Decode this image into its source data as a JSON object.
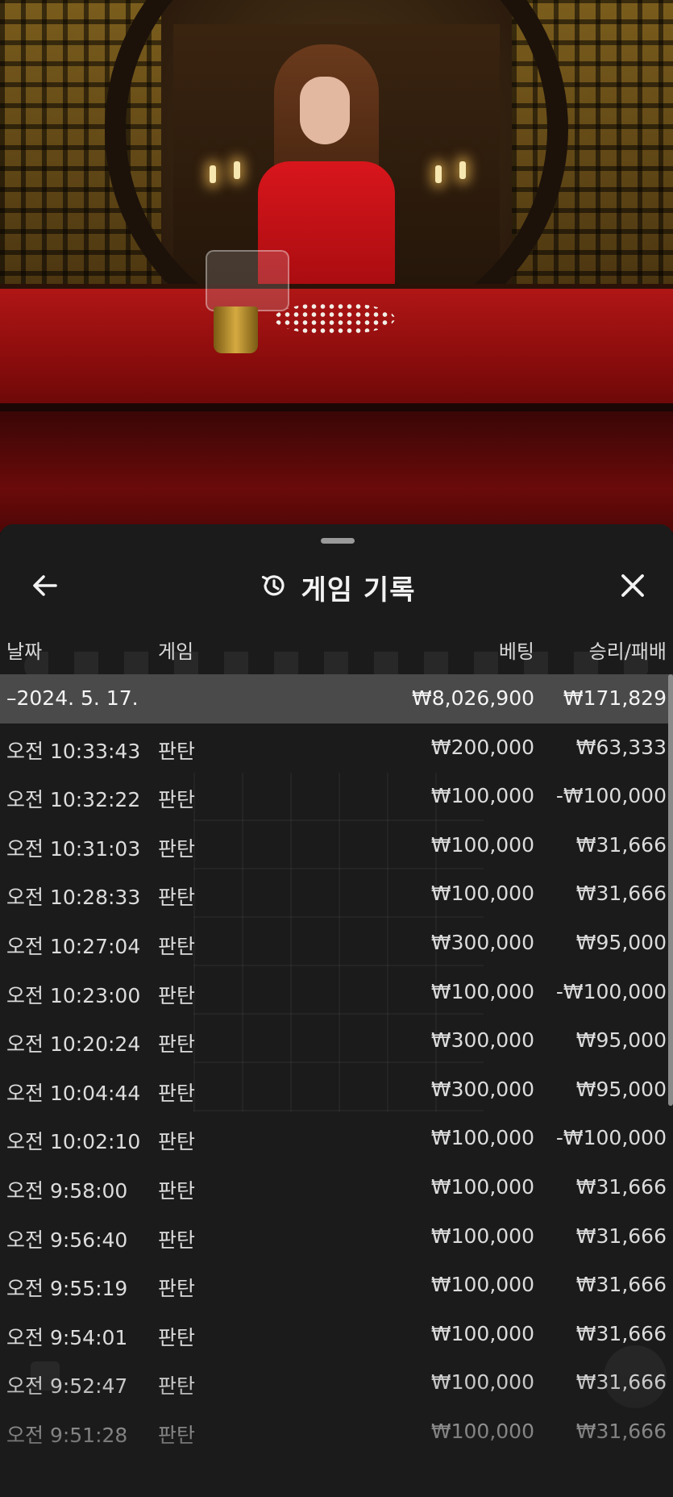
{
  "sheet": {
    "title": "게임 기록",
    "icons": {
      "back": "arrow-left-icon",
      "history": "history-clock-icon",
      "close": "close-x-icon"
    }
  },
  "columns": {
    "date": "날짜",
    "game": "게임",
    "bet": "베팅",
    "result": "승리/패배"
  },
  "date_group": {
    "date": "–2024. 5. 17.",
    "bet": "₩8,026,900",
    "result": "₩171,829"
  },
  "rows": [
    {
      "time": "오전 10:33:43",
      "game": "판탄",
      "bet": "₩200,000",
      "result": "₩63,333"
    },
    {
      "time": "오전 10:32:22",
      "game": "판탄",
      "bet": "₩100,000",
      "result": "-₩100,000"
    },
    {
      "time": "오전 10:31:03",
      "game": "판탄",
      "bet": "₩100,000",
      "result": "₩31,666"
    },
    {
      "time": "오전 10:28:33",
      "game": "판탄",
      "bet": "₩100,000",
      "result": "₩31,666"
    },
    {
      "time": "오전 10:27:04",
      "game": "판탄",
      "bet": "₩300,000",
      "result": "₩95,000"
    },
    {
      "time": "오전 10:23:00",
      "game": "판탄",
      "bet": "₩100,000",
      "result": "-₩100,000"
    },
    {
      "time": "오전 10:20:24",
      "game": "판탄",
      "bet": "₩300,000",
      "result": "₩95,000"
    },
    {
      "time": "오전 10:04:44",
      "game": "판탄",
      "bet": "₩300,000",
      "result": "₩95,000"
    },
    {
      "time": "오전 10:02:10",
      "game": "판탄",
      "bet": "₩100,000",
      "result": "-₩100,000"
    },
    {
      "time": "오전 9:58:00",
      "game": "판탄",
      "bet": "₩100,000",
      "result": "₩31,666"
    },
    {
      "time": "오전 9:56:40",
      "game": "판탄",
      "bet": "₩100,000",
      "result": "₩31,666"
    },
    {
      "time": "오전 9:55:19",
      "game": "판탄",
      "bet": "₩100,000",
      "result": "₩31,666"
    },
    {
      "time": "오전 9:54:01",
      "game": "판탄",
      "bet": "₩100,000",
      "result": "₩31,666"
    },
    {
      "time": "오전 9:52:47",
      "game": "판탄",
      "bet": "₩100,000",
      "result": "₩31,666"
    },
    {
      "time": "오전 9:51:28",
      "game": "판탄",
      "bet": "₩100,000",
      "result": "₩31,666"
    }
  ],
  "colors": {
    "sheet_bg": "#1b1b1b",
    "date_row_bg": "#4a4a4a",
    "table_felt": "#b01616"
  }
}
